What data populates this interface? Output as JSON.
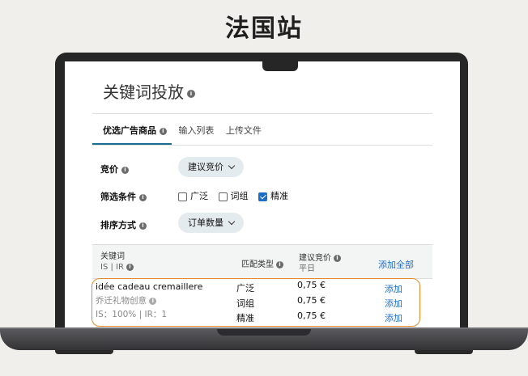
{
  "heading": "法国站",
  "panel": {
    "title": "关键词投放",
    "tabs": [
      "优选广告商品",
      "输入列表",
      "上传文件"
    ],
    "bid": {
      "label": "竞价",
      "value": "建议竞价"
    },
    "filter": {
      "label": "筛选条件",
      "options": [
        {
          "label": "广泛",
          "checked": false
        },
        {
          "label": "词组",
          "checked": false
        },
        {
          "label": "精准",
          "checked": true
        }
      ]
    },
    "sort": {
      "label": "排序方式",
      "value": "订单数量"
    },
    "table": {
      "col_keyword": "关键词",
      "col_keyword_sub": "IS | IR",
      "col_match": "匹配类型",
      "col_bid": "建议竞价",
      "col_bid_sub": "平日",
      "add_all": "添加全部",
      "keyword": "idée cadeau cremaillere",
      "keyword_translation": "乔迁礼物创意",
      "stats": "IS：100% | IR：1",
      "rows": [
        {
          "match": "广泛",
          "bid": "0,75 €",
          "action": "添加"
        },
        {
          "match": "词组",
          "bid": "0,75 €",
          "action": "添加"
        },
        {
          "match": "精准",
          "bid": "0,75 €",
          "action": "添加"
        }
      ]
    }
  }
}
